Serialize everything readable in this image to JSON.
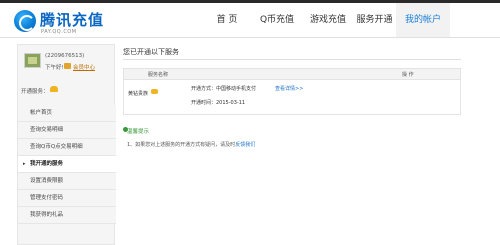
{
  "header": {
    "logo_title": "腾讯充值",
    "logo_sub": "PAY.QQ.COM",
    "nav": [
      "首 页",
      "Q币充值",
      "游戏充值",
      "服务开通",
      "我的帐户"
    ],
    "active_nav": "我的帐户"
  },
  "sidebar": {
    "qq": "(2209676513)",
    "greeting": "下午好!",
    "vip_link": "会员中心",
    "services_label": "开通服务：",
    "menu": [
      "帐户首页",
      "查询交易明细",
      "查询Q币Q点交易明细",
      "我开通的服务",
      "设置消费限额",
      "管理支付密码",
      "我获得的礼品"
    ],
    "current_item": "我开通的服务"
  },
  "main": {
    "title": "您已开通以下服务",
    "table": {
      "col_name": "服务名称",
      "col_op": "操 作",
      "rows": [
        {
          "name": "黄钻贵族",
          "method": "开通方式：中国移动手机支付",
          "detail_link": "查看详情>>",
          "date": "开通时间：2015-03-11"
        }
      ]
    },
    "tips": {
      "title": "温馨提示",
      "text": "1、如果您对上述服务的开通方式有疑问，请及时",
      "link": "反馈我们"
    }
  },
  "colors": {
    "brand_blue": "#0a66c2",
    "link_blue": "#1a6fc9",
    "tip_green": "#3a9a3a",
    "vip_gold": "#f0b323"
  }
}
